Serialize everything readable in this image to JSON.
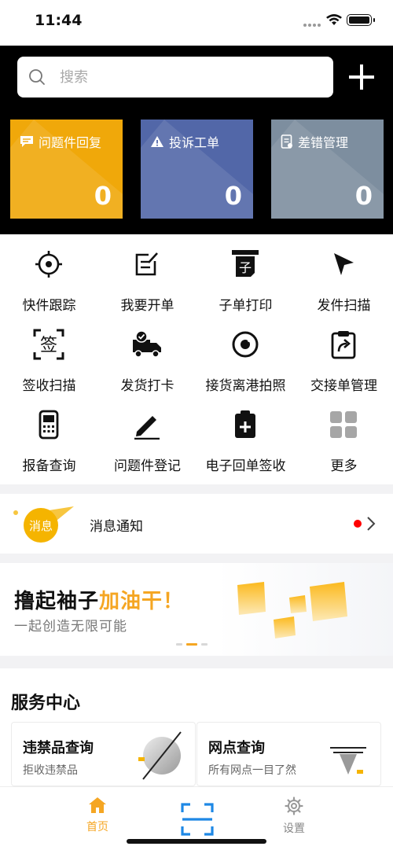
{
  "status_bar": {
    "time": "11:44"
  },
  "search": {
    "placeholder": "搜索"
  },
  "cards": [
    {
      "title": "问题件回复",
      "count": "0",
      "color": "#f0a80a"
    },
    {
      "title": "投诉工单",
      "count": "0",
      "color": "#5267a8"
    },
    {
      "title": "差错管理",
      "count": "0",
      "color": "#7d8e9f"
    }
  ],
  "grid": [
    {
      "label": "快件跟踪",
      "icon": "crosshair-icon"
    },
    {
      "label": "我要开单",
      "icon": "edit-form-icon"
    },
    {
      "label": "子单打印",
      "icon": "printer-icon"
    },
    {
      "label": "发件扫描",
      "icon": "cursor-arrow-icon"
    },
    {
      "label": "签收扫描",
      "icon": "sign-scan-icon"
    },
    {
      "label": "发货打卡",
      "icon": "truck-check-icon"
    },
    {
      "label": "接货离港拍照",
      "icon": "camera-lens-icon"
    },
    {
      "label": "交接单管理",
      "icon": "clipboard-share-icon"
    },
    {
      "label": "报备查询",
      "icon": "calculator-icon"
    },
    {
      "label": "问题件登记",
      "icon": "pencil-icon"
    },
    {
      "label": "电子回单签收",
      "icon": "clipboard-plus-icon"
    },
    {
      "label": "更多",
      "icon": "more-grid-icon"
    }
  ],
  "cube_glyph": "子",
  "notice": {
    "badge": "消息",
    "text": "消息通知"
  },
  "banner": {
    "line1_a": "撸起袖子",
    "line1_b": "加油干！",
    "line2": "一起创造无限可能"
  },
  "service": {
    "title": "服务中心",
    "cards": [
      {
        "title": "违禁品查询",
        "subtitle": "拒收违禁品"
      },
      {
        "title": "网点查询",
        "subtitle": "所有网点一目了然"
      }
    ]
  },
  "tabbar": {
    "home": "首页",
    "settings": "设置",
    "active_color": "#f5a623",
    "scan_color": "#1e88e5"
  }
}
